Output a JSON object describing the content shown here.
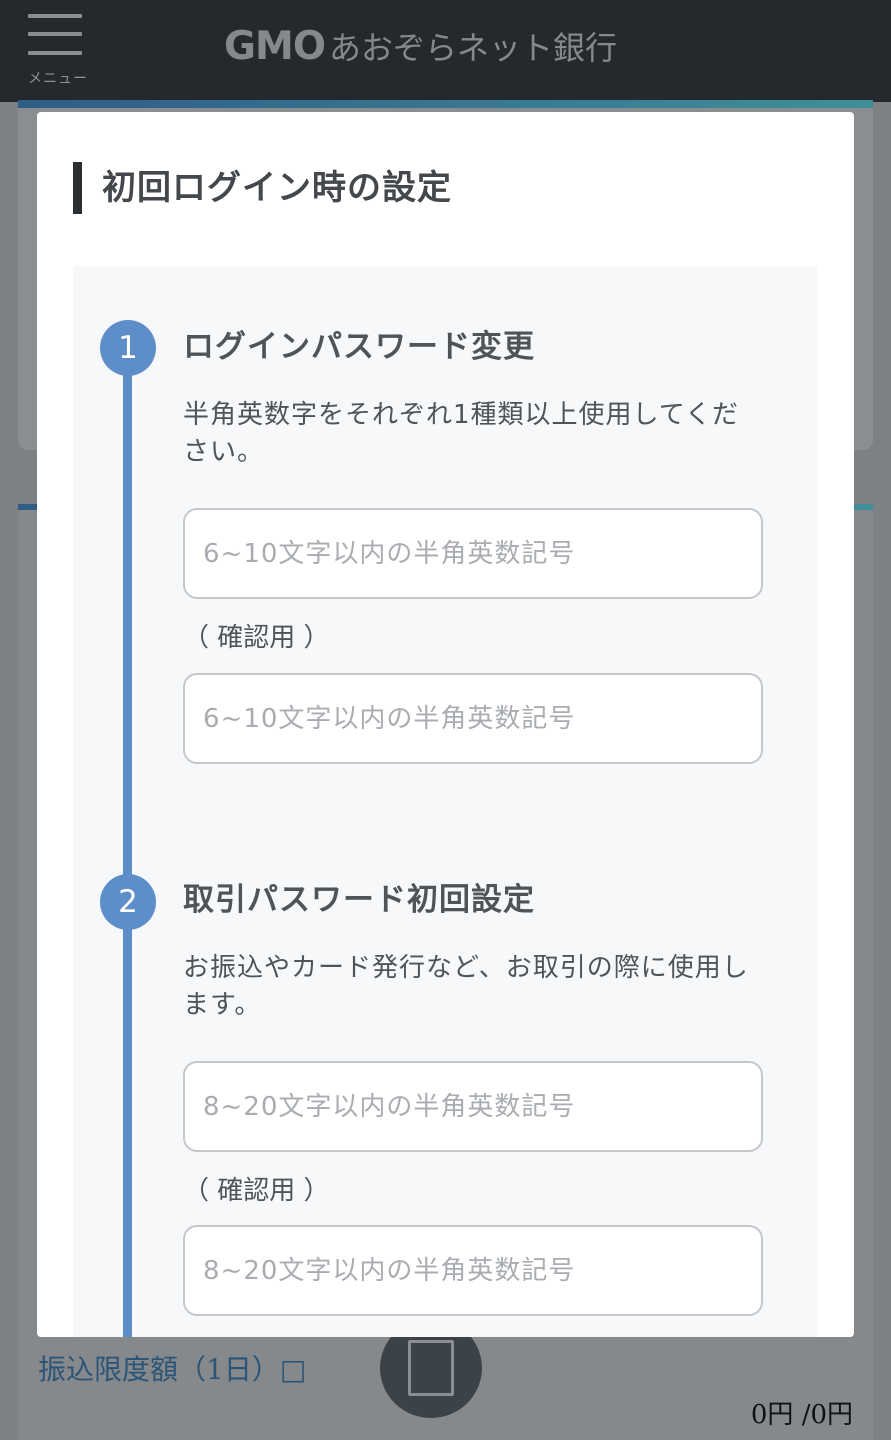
{
  "header": {
    "menu_label": "メニュー",
    "logo_brand": "GMO",
    "logo_name": "あおぞらネット銀行"
  },
  "background": {
    "transfer_limit_label": "振込限度額（1日）□",
    "amount_text": "0円 /0円"
  },
  "modal": {
    "title": "初回ログイン時の設定",
    "steps": [
      {
        "number": "1",
        "title": "ログインパスワード変更",
        "description": "半角英数字をそれぞれ1種類以上使用してください。",
        "input_placeholder": "6~10文字以内の半角英数記号",
        "confirm_label": "（ 確認用 ）",
        "confirm_placeholder": "6~10文字以内の半角英数記号"
      },
      {
        "number": "2",
        "title": "取引パスワード初回設定",
        "description": "お振込やカード発行など、お取引の際に使用します。",
        "input_placeholder": "8~20文字以内の半角英数記号",
        "confirm_label": "（ 確認用 ）",
        "confirm_placeholder": "8~20文字以内の半角英数記号"
      }
    ]
  },
  "colors": {
    "accent": "#5e8ec9",
    "header_bg": "#25292d",
    "title_bar": "#2b2f33"
  }
}
